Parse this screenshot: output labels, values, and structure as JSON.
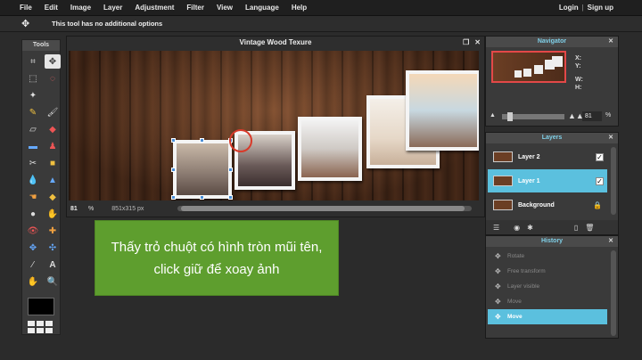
{
  "menu": [
    "File",
    "Edit",
    "Image",
    "Layer",
    "Adjustment",
    "Filter",
    "View",
    "Language",
    "Help"
  ],
  "auth": {
    "login": "Login",
    "separator": "|",
    "signup": "Sign up"
  },
  "options": {
    "message": "This tool has no additional options"
  },
  "tools": {
    "title": "Tools"
  },
  "canvas": {
    "title": "Vintage Wood Texure",
    "zoom": "81",
    "zoom_unit": "%",
    "size": "851x315 px"
  },
  "caption": {
    "text": "Thấy trỏ chuột có hình tròn mũi tên, click giữ để xoay ảnh"
  },
  "navigator": {
    "title": "Navigator",
    "x_label": "X:",
    "y_label": "Y:",
    "w_label": "W:",
    "h_label": "H:",
    "zoom_value": "81",
    "zoom_unit": "%"
  },
  "layers": {
    "title": "Layers",
    "items": [
      {
        "name": "Layer 2",
        "visible": true,
        "selected": false
      },
      {
        "name": "Layer 1",
        "visible": true,
        "selected": true
      },
      {
        "name": "Background",
        "locked": true,
        "selected": false
      }
    ]
  },
  "history": {
    "title": "History",
    "items": [
      "Rotate",
      "Free transform",
      "Layer visible",
      "Move",
      "Move"
    ],
    "selected_index": 4
  },
  "colors": {
    "accent": "#5bc0de",
    "caption_bg": "#5e9e2e",
    "handle": "#4a8fd8",
    "rotate_circle": "#d83a2a"
  }
}
